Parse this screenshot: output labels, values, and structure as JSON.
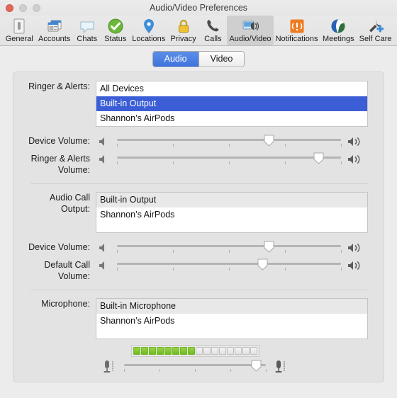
{
  "window": {
    "title": "Audio/Video Preferences",
    "traffic_lights": [
      "close",
      "minimize",
      "zoom"
    ]
  },
  "toolbar": {
    "items": [
      {
        "label": "General",
        "icon": "general-icon",
        "selected": false
      },
      {
        "label": "Accounts",
        "icon": "accounts-icon",
        "selected": false
      },
      {
        "label": "Chats",
        "icon": "chats-icon",
        "selected": false
      },
      {
        "label": "Status",
        "icon": "status-icon",
        "selected": false
      },
      {
        "label": "Locations",
        "icon": "locations-icon",
        "selected": false
      },
      {
        "label": "Privacy",
        "icon": "privacy-lock-icon",
        "selected": false
      },
      {
        "label": "Calls",
        "icon": "calls-phone-icon",
        "selected": false
      },
      {
        "label": "Audio/Video",
        "icon": "audio-video-icon",
        "selected": true
      },
      {
        "label": "Notifications",
        "icon": "notifications-icon",
        "selected": false
      },
      {
        "label": "Meetings",
        "icon": "meetings-icon",
        "selected": false
      },
      {
        "label": "Self Care",
        "icon": "self-care-icon",
        "selected": false
      }
    ]
  },
  "tabs": {
    "audio": "Audio",
    "video": "Video",
    "selected": "Audio"
  },
  "sections": {
    "ringer": {
      "label": "Ringer & Alerts:",
      "options": [
        {
          "text": "All Devices",
          "selected": false
        },
        {
          "text": "Built-in Output",
          "selected": true
        },
        {
          "text": "Shannon’s AirPods",
          "selected": false
        }
      ],
      "sliders": [
        {
          "label": "Device Volume:",
          "value": 68
        },
        {
          "label": "Ringer & Alerts Volume:",
          "value": 90
        }
      ]
    },
    "audio_call_output": {
      "label": "Audio Call Output:",
      "options": [
        {
          "text": "Built-in Output",
          "selected": false,
          "tint": true
        },
        {
          "text": "Shannon’s AirPods",
          "selected": false,
          "tint": false
        }
      ],
      "sliders": [
        {
          "label": "Device Volume:",
          "value": 68
        },
        {
          "label": "Default Call Volume:",
          "value": 65
        }
      ]
    },
    "microphone": {
      "label": "Microphone:",
      "options": [
        {
          "text": "Built-in Microphone",
          "selected": false,
          "tint": true
        },
        {
          "text": "Shannon’s AirPods",
          "selected": false,
          "tint": false
        }
      ],
      "level_meter": {
        "total_segments": 16,
        "lit_segments": 8
      },
      "input_slider": {
        "value": 93
      }
    }
  },
  "colors": {
    "accent_selection": "#3b5ed7",
    "tab_active": "#3f74de",
    "meter_lit": "#6fbb1f",
    "window_bg": "#ececec",
    "panel_bg": "#e3e3e3"
  },
  "ticks_per_slider": 5
}
